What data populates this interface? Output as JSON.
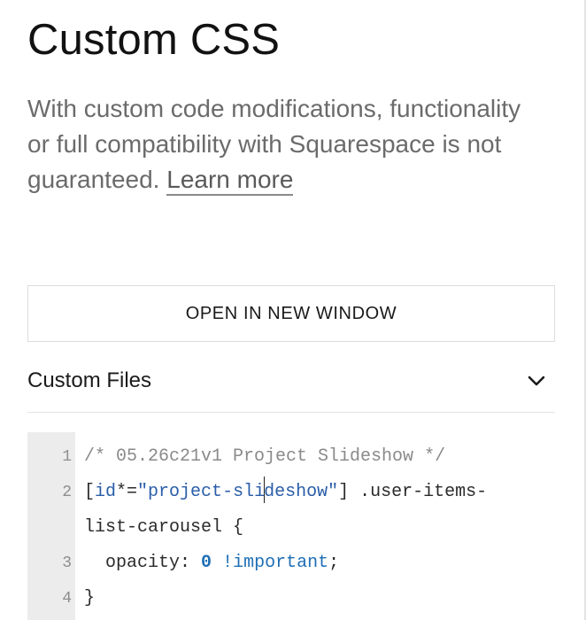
{
  "header": {
    "title": "Custom CSS",
    "description": "With custom code modifications, functionality or full compatibility with Squarespace is not guaranteed. ",
    "learn_more": "Learn more"
  },
  "actions": {
    "open_in_new_window": "OPEN IN NEW WINDOW"
  },
  "custom_files": {
    "label": "Custom Files",
    "expanded": false,
    "icon": "chevron-down-icon"
  },
  "editor": {
    "lines": [
      {
        "number": "1",
        "tokens": [
          {
            "kind": "comment",
            "text": "/* 05.26c21v1 Project Slideshow */"
          }
        ]
      },
      {
        "number": "2",
        "tokens": [
          {
            "kind": "plain",
            "text": "["
          },
          {
            "kind": "attr",
            "text": "id"
          },
          {
            "kind": "plain",
            "text": "*="
          },
          {
            "kind": "string",
            "text": "\"project-sli"
          },
          {
            "kind": "string",
            "text": "deshow\""
          },
          {
            "kind": "plain",
            "text": "] .user-items-"
          }
        ]
      },
      {
        "number": "",
        "tokens": [
          {
            "kind": "plain",
            "text": "list-carousel {"
          }
        ]
      },
      {
        "number": "3",
        "tokens": [
          {
            "kind": "plain",
            "text": "  opacity: "
          },
          {
            "kind": "num",
            "text": "0"
          },
          {
            "kind": "plain",
            "text": " "
          },
          {
            "kind": "important",
            "text": "!important"
          },
          {
            "kind": "plain",
            "text": ";"
          }
        ]
      },
      {
        "number": "4",
        "tokens": [
          {
            "kind": "plain",
            "text": "}"
          }
        ]
      }
    ]
  },
  "colors": {
    "gutter_bg": "#ececec",
    "keyword_blue": "#1f6fb5",
    "comment_gray": "#8a8a8a"
  }
}
